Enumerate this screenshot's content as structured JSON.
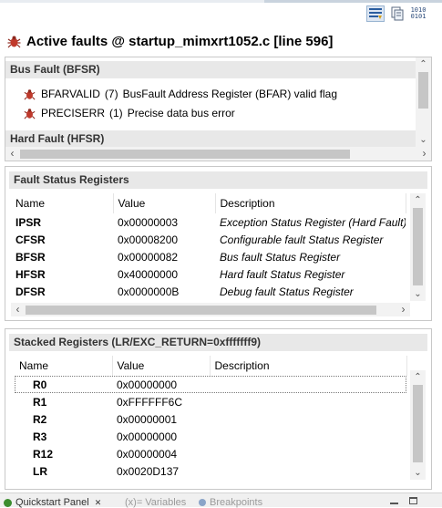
{
  "toolbar": {
    "icons": [
      "show-details-icon",
      "copy-icon",
      "binary-format-icon"
    ],
    "binary_icon_top": "1010",
    "binary_icon_bottom": "0101"
  },
  "title": "Active faults @ startup_mimxrt1052.c [line 596]",
  "fault_sections": [
    {
      "header": "Bus Fault (BFSR)",
      "items": [
        {
          "name": "BFARVALID",
          "count": "(7)",
          "desc": "BusFault Address Register (BFAR) valid flag"
        },
        {
          "name": "PRECISERR",
          "count": "(1)",
          "desc": "Precise data bus error"
        }
      ]
    },
    {
      "header": "Hard Fault (HFSR)",
      "items": []
    }
  ],
  "fault_status": {
    "header": "Fault Status Registers",
    "columns": [
      "Name",
      "Value",
      "Description"
    ],
    "rows": [
      {
        "name": "IPSR",
        "value": "0x00000003",
        "desc": "Exception Status Register (Hard Fault)"
      },
      {
        "name": "CFSR",
        "value": "0x00008200",
        "desc": "Configurable fault Status Register"
      },
      {
        "name": "BFSR",
        "value": "0x00000082",
        "desc": "Bus fault Status Register"
      },
      {
        "name": "HFSR",
        "value": "0x40000000",
        "desc": "Hard fault Status Register"
      },
      {
        "name": "DFSR",
        "value": "0x0000000B",
        "desc": "Debug fault Status Register"
      }
    ]
  },
  "stacked": {
    "header": "Stacked Registers (LR/EXC_RETURN=0xfffffff9)",
    "columns": [
      "Name",
      "Value",
      "Description"
    ],
    "rows": [
      {
        "name": "R0",
        "value": "0x00000000",
        "desc": ""
      },
      {
        "name": "R1",
        "value": "0xFFFFFF6C",
        "desc": ""
      },
      {
        "name": "R2",
        "value": "0x00000001",
        "desc": ""
      },
      {
        "name": "R3",
        "value": "0x00000000",
        "desc": ""
      },
      {
        "name": "R12",
        "value": "0x00000004",
        "desc": ""
      },
      {
        "name": "LR",
        "value": "0x0020D137",
        "desc": ""
      }
    ]
  },
  "bottom_tabs": [
    {
      "label": "Quickstart Panel",
      "close": "✕",
      "active": true
    },
    {
      "label": "Variables",
      "prefix": "(x)=",
      "active": false
    },
    {
      "label": "Breakpoints",
      "active": false
    }
  ],
  "colors": {
    "bug_red": "#c0392b",
    "selection_border": "#7a7a7a",
    "header_bg": "#e8e8e8"
  }
}
